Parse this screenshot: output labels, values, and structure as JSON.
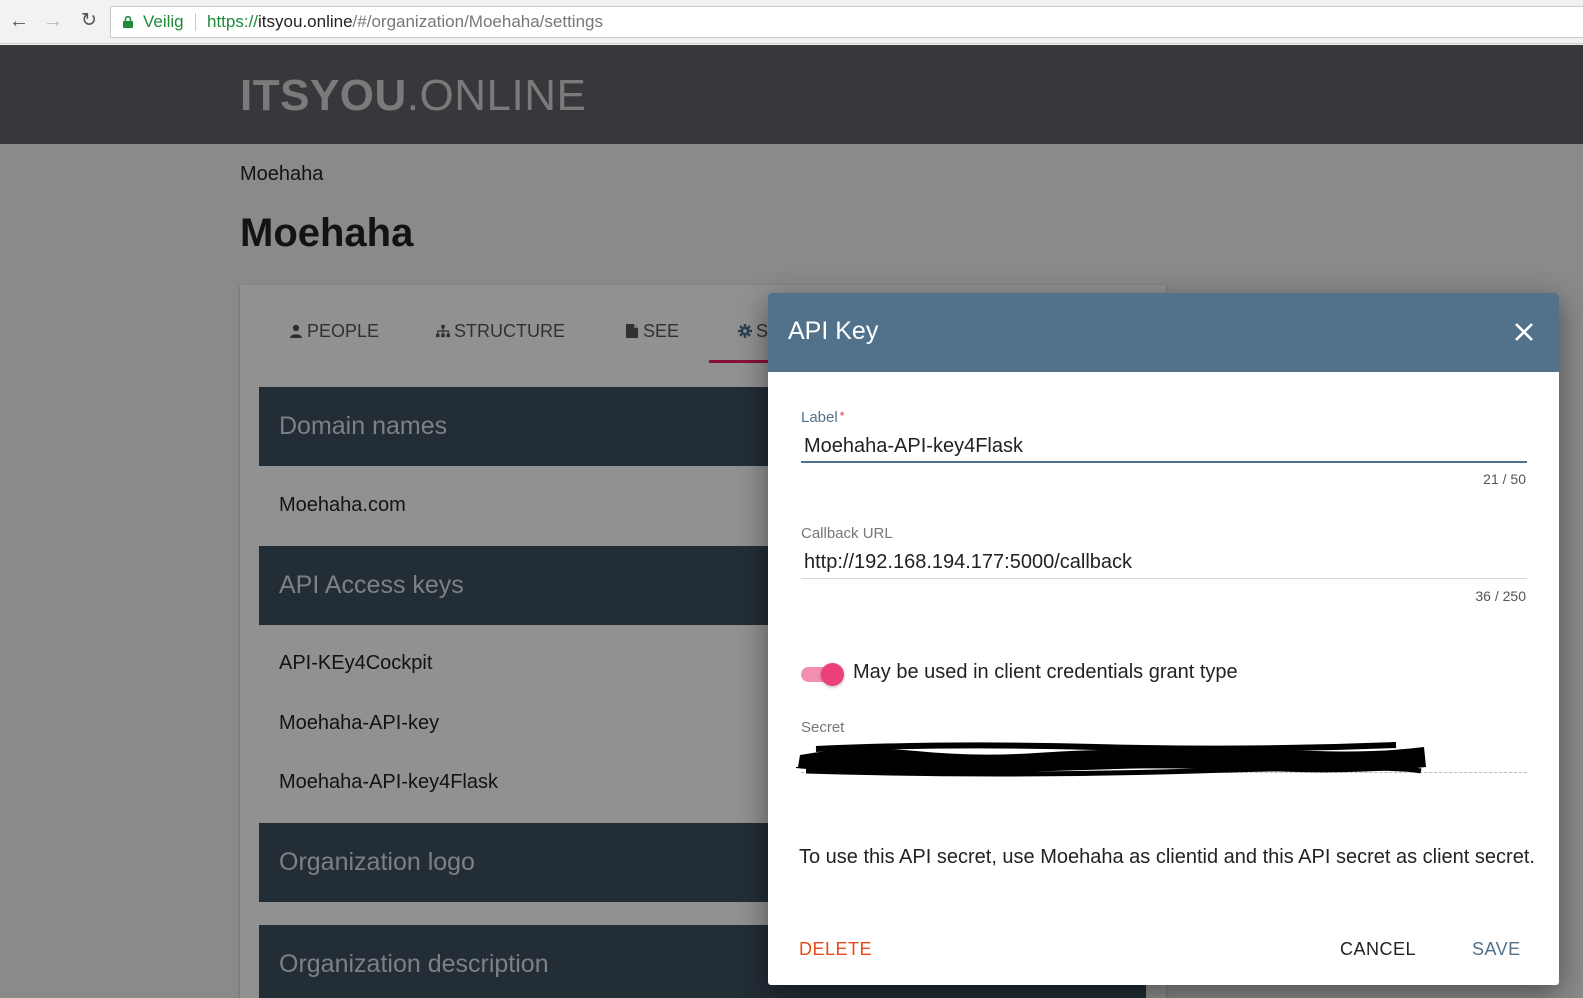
{
  "browser": {
    "secure_label": "Veilig",
    "url_scheme": "https://",
    "url_host": "itsyou.online",
    "url_path": "/#/organization/Moehaha/settings"
  },
  "app": {
    "brand_bold": "ITSYOU",
    "brand_light": ".ONLINE",
    "breadcrumb": "Moehaha",
    "page_title": "Moehaha"
  },
  "tabs": [
    {
      "label": "PEOPLE",
      "icon": "user-icon"
    },
    {
      "label": "STRUCTURE",
      "icon": "sitemap-icon"
    },
    {
      "label": "SEE",
      "icon": "file-icon"
    },
    {
      "label": "S",
      "icon": "gear-icon",
      "active": true
    }
  ],
  "sections": {
    "domain_names": {
      "title": "Domain names",
      "items": [
        "Moehaha.com"
      ]
    },
    "api_access_keys": {
      "title": "API Access keys",
      "items": [
        "API-KEy4Cockpit",
        "Moehaha-API-key",
        "Moehaha-API-key4Flask"
      ]
    },
    "organization_logo": {
      "title": "Organization logo"
    },
    "organization_description": {
      "title": "Organization description"
    }
  },
  "dialog": {
    "title": "API Key",
    "label_field": {
      "label": "Label",
      "required_mark": "*",
      "value": "Moehaha-API-key4Flask",
      "counter": "21 / 50"
    },
    "callback_field": {
      "label": "Callback URL",
      "value": "http://192.168.194.177:5000/callback",
      "counter": "36 / 250"
    },
    "client_credentials_toggle": {
      "label": "May be used in client credentials grant type",
      "checked": true
    },
    "secret_field": {
      "label": "Secret"
    },
    "help_text": "To use this API secret, use Moehaha as clientid and this API secret as client secret.",
    "buttons": {
      "delete": "DELETE",
      "cancel": "CANCEL",
      "save": "SAVE"
    }
  },
  "colors": {
    "header_bg": "#5f6166",
    "section_bg": "#3d4f5e",
    "dialog_header": "#52728c",
    "accent_pink": "#ec407a",
    "delete_red": "#e64a19"
  }
}
